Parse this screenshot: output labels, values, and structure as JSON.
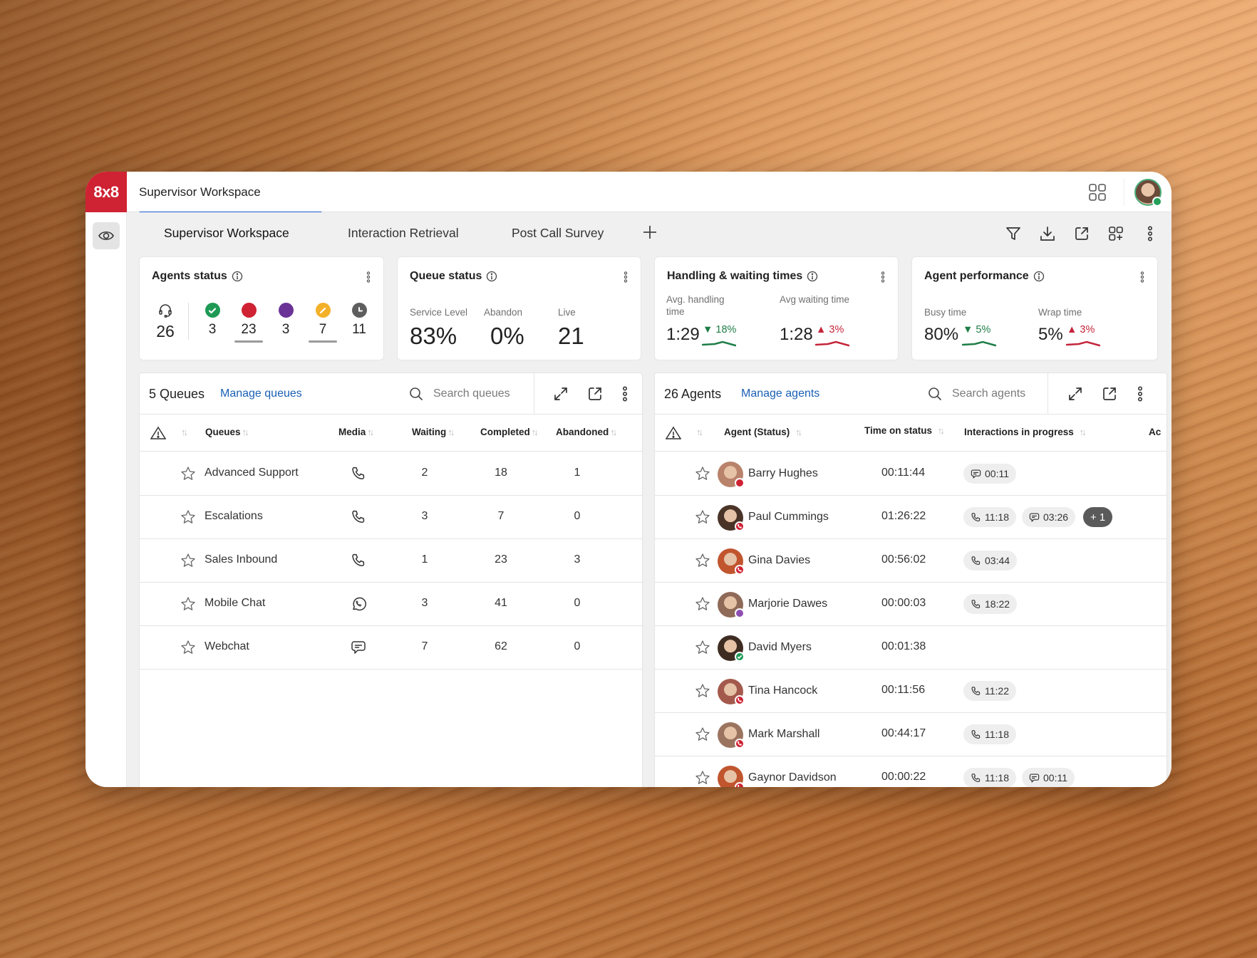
{
  "app": {
    "logo": "8x8",
    "title": "Supervisor Workspace"
  },
  "tabs": [
    {
      "label": "Supervisor Workspace",
      "active": true
    },
    {
      "label": "Interaction Retrieval",
      "active": false
    },
    {
      "label": "Post Call Survey",
      "active": false
    }
  ],
  "toolbar_icons": [
    "filter-icon",
    "download-icon",
    "external-link-icon",
    "add-widget-icon",
    "more-vertical-icon"
  ],
  "agents_status": {
    "title": "Agents status",
    "total": "26",
    "statuses": [
      {
        "name": "available",
        "color": "#1e9a55",
        "count": "3",
        "underlined": false
      },
      {
        "name": "busy",
        "color": "#cf2233",
        "count": "23",
        "underlined": true
      },
      {
        "name": "working-offline",
        "color": "#6b3396",
        "count": "3",
        "underlined": false
      },
      {
        "name": "break",
        "color": "#f3b12a",
        "count": "7",
        "underlined": true
      },
      {
        "name": "offline",
        "color": "#5e5e5e",
        "count": "11",
        "underlined": false
      }
    ]
  },
  "queue_status": {
    "title": "Queue status",
    "metrics": [
      {
        "label": "Service Level",
        "value": "83%"
      },
      {
        "label": "Abandon",
        "value": "0%"
      },
      {
        "label": "Live",
        "value": "21"
      }
    ]
  },
  "handling_times": {
    "title": "Handling & waiting times",
    "metrics": [
      {
        "label": "Avg. handling time",
        "value": "1:29",
        "delta": "18%",
        "direction": "down",
        "color": "#1e7d47"
      },
      {
        "label": "Avg waiting time",
        "value": "1:28",
        "delta": "3%",
        "direction": "up",
        "color": "#c4253b"
      }
    ]
  },
  "agent_performance": {
    "title": "Agent performance",
    "metrics": [
      {
        "label": "Busy time",
        "value": "80%",
        "delta": "5%",
        "direction": "down",
        "color": "#1e7d47"
      },
      {
        "label": "Wrap time",
        "value": "5%",
        "delta": "3%",
        "direction": "up",
        "color": "#c4253b"
      }
    ]
  },
  "queues_panel": {
    "count_label": "5 Queues",
    "manage_label": "Manage queues",
    "search_placeholder": "Search queues",
    "columns": [
      "Queues",
      "Media",
      "Waiting",
      "Completed",
      "Abandoned"
    ],
    "rows": [
      {
        "name": "Advanced Support",
        "media": "phone",
        "waiting": "2",
        "completed": "18",
        "abandoned": "1"
      },
      {
        "name": "Escalations",
        "media": "phone",
        "waiting": "3",
        "completed": "7",
        "abandoned": "0"
      },
      {
        "name": "Sales Inbound",
        "media": "phone",
        "waiting": "1",
        "completed": "23",
        "abandoned": "3"
      },
      {
        "name": "Mobile Chat",
        "media": "whatsapp",
        "waiting": "3",
        "completed": "41",
        "abandoned": "0"
      },
      {
        "name": "Webchat",
        "media": "chat",
        "waiting": "7",
        "completed": "62",
        "abandoned": "0"
      }
    ]
  },
  "agents_panel": {
    "count_label": "26 Agents",
    "manage_label": "Manage agents",
    "search_placeholder": "Search agents",
    "columns": [
      "Agent (Status)",
      "Time on status",
      "Interactions in progress",
      "Ac"
    ],
    "rows": [
      {
        "name": "Barry Hughes",
        "status": "busy",
        "time": "00:11:44",
        "interactions": [
          {
            "type": "chat",
            "time": "00:11"
          }
        ],
        "more": ""
      },
      {
        "name": "Paul Cummings",
        "status": "on-call",
        "time": "01:26:22",
        "interactions": [
          {
            "type": "phone",
            "time": "11:18"
          },
          {
            "type": "chat",
            "time": "03:26"
          }
        ],
        "more": "+ 1"
      },
      {
        "name": "Gina Davies",
        "status": "on-call",
        "time": "00:56:02",
        "interactions": [
          {
            "type": "phone",
            "time": "03:44"
          }
        ],
        "more": ""
      },
      {
        "name": "Marjorie Dawes",
        "status": "working-offline",
        "time": "00:00:03",
        "interactions": [
          {
            "type": "phone",
            "time": "18:22"
          }
        ],
        "more": ""
      },
      {
        "name": "David Myers",
        "status": "available",
        "time": "00:01:38",
        "interactions": [],
        "more": ""
      },
      {
        "name": "Tina Hancock",
        "status": "on-call",
        "time": "00:11:56",
        "interactions": [
          {
            "type": "phone",
            "time": "11:22"
          }
        ],
        "more": ""
      },
      {
        "name": "Mark Marshall",
        "status": "on-call",
        "time": "00:44:17",
        "interactions": [
          {
            "type": "phone",
            "time": "11:18"
          }
        ],
        "more": ""
      },
      {
        "name": "Gaynor Davidson",
        "status": "on-call",
        "time": "00:00:22",
        "interactions": [
          {
            "type": "phone",
            "time": "11:18"
          },
          {
            "type": "chat",
            "time": "00:11"
          }
        ],
        "more": ""
      }
    ]
  }
}
